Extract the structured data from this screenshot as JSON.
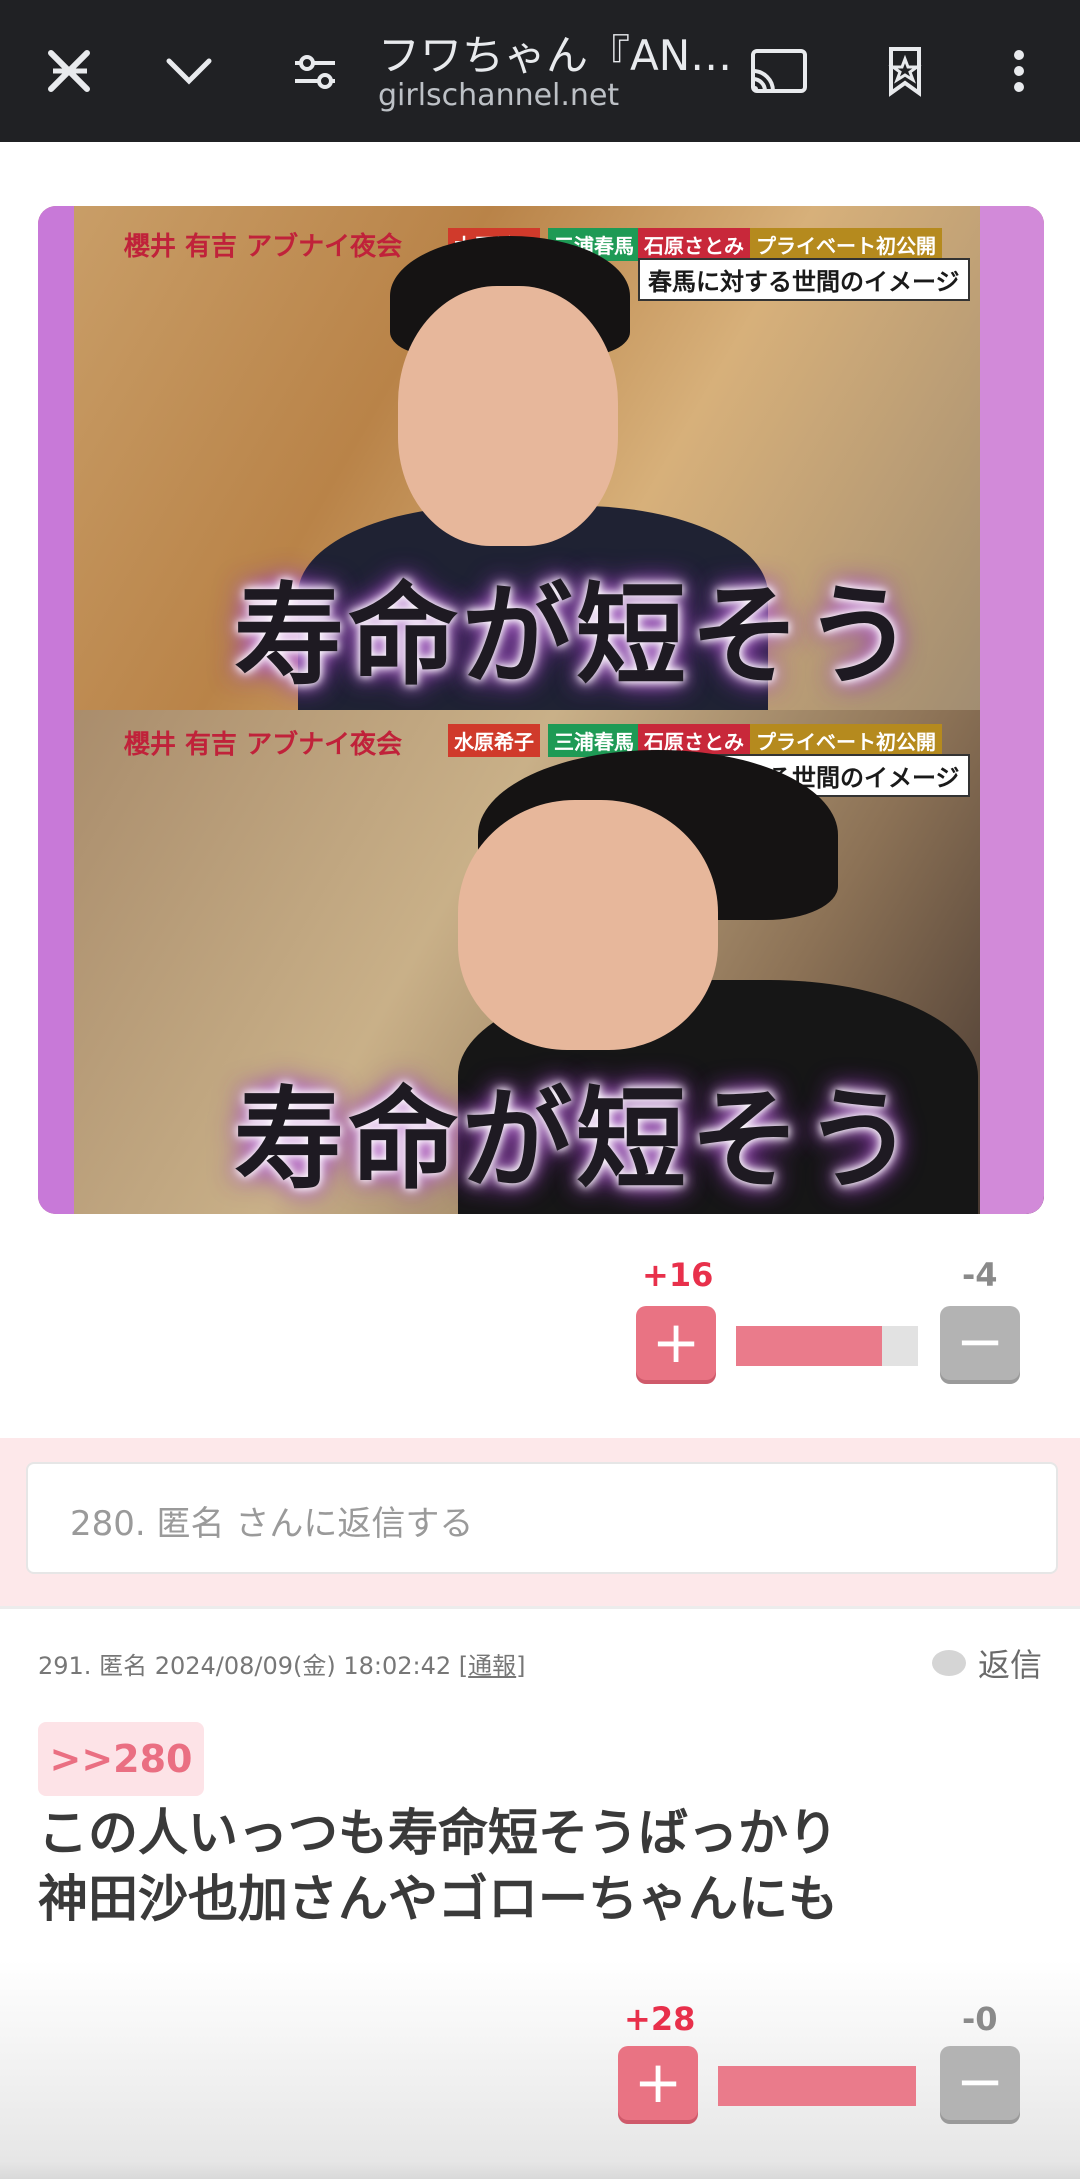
{
  "browser": {
    "title": "フワちゃん『AN…",
    "url": "girlschannel.net",
    "icons": [
      "close-icon",
      "chevron-down-icon",
      "page-settings-icon",
      "cast-icon",
      "bookmark-star-icon",
      "more-vert-icon"
    ]
  },
  "post_image": {
    "show_logo": "櫻井 有吉 アブナイ夜会",
    "guest_tags": [
      "水原希子",
      "三浦春馬",
      "石原さとみ",
      "プライベート初公開"
    ],
    "caption_bar": "春馬に対する世間のイメージ",
    "big_caption": "寿命が短そう"
  },
  "vote1": {
    "plus": "+16",
    "minus": "-4",
    "ratio": 0.8
  },
  "reply_box": {
    "placeholder": "280. 匿名 さんに返信する"
  },
  "comment": {
    "meta_prefix": "291. 匿名 2024/08/09(金) 18:02:42 [",
    "report": "通報",
    "meta_suffix": "]",
    "reply_label": "返信",
    "anchor": ">>280",
    "line1": "この人いっつも寿命短そうばっかり",
    "line2": "神田沙也加さんやゴローちゃんにも"
  },
  "vote2": {
    "plus": "+28",
    "minus": "-0",
    "ratio": 1.0
  },
  "colors": {
    "plus": "#ea7b8b",
    "minus": "#b3b3b3",
    "reply_bg": "#fde8ea",
    "topbar": "#202124"
  }
}
